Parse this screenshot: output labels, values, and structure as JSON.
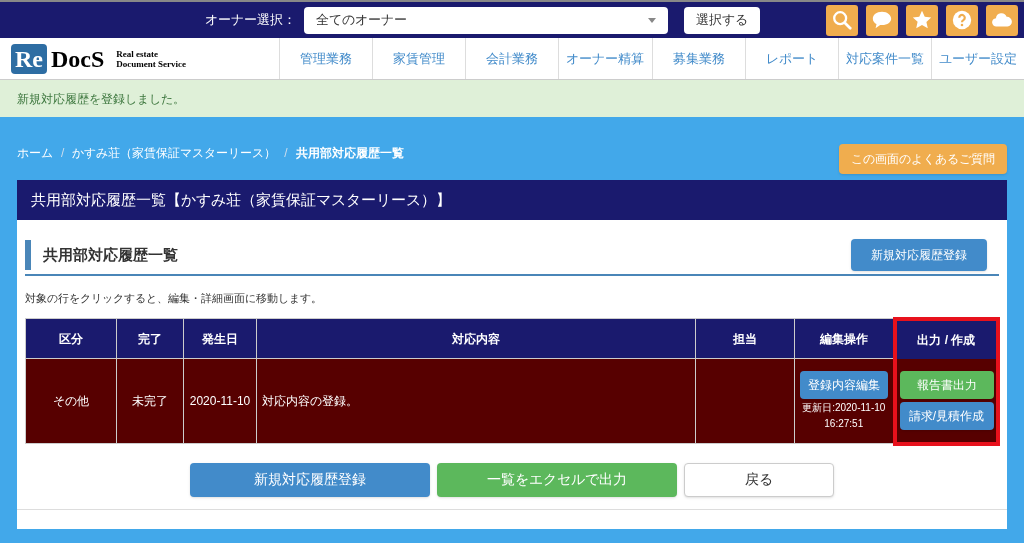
{
  "owner_select": {
    "label": "オーナー選択：",
    "value": "全てのオーナー",
    "button": "選択する"
  },
  "toolbar_icons": [
    {
      "kind": "search"
    },
    {
      "kind": "chat"
    },
    {
      "kind": "star"
    },
    {
      "kind": "help"
    },
    {
      "kind": "cloud"
    }
  ],
  "logo": {
    "mark": "Re",
    "name": "DocS",
    "tagline_1": "Real estate",
    "tagline_2": "Document Service"
  },
  "nav": [
    "管理業務",
    "家賃管理",
    "会計業務",
    "オーナー精算",
    "募集業務",
    "レポート",
    "対応案件一覧",
    "ユーザー設定"
  ],
  "alert": "新規対応履歴を登録しました。",
  "breadcrumb": [
    "ホーム",
    "かすみ荘（家賃保証マスターリース）",
    "共用部対応履歴一覧"
  ],
  "breadcrumb_separator": "/",
  "faq_button": "この画面のよくあるご質問",
  "panel_title": "共用部対応履歴一覧【かすみ荘（家賃保証マスターリース）】",
  "section_title": "共用部対応履歴一覧",
  "new_button": "新規対応履歴登録",
  "hint": "対象の行をクリックすると、編集・詳細画面に移動します。",
  "table": {
    "columns": [
      {
        "label": "区分",
        "highlighted": false
      },
      {
        "label": "完了",
        "highlighted": false
      },
      {
        "label": "発生日",
        "highlighted": false
      },
      {
        "label": "対応内容",
        "highlighted": false
      },
      {
        "label": "担当",
        "highlighted": false
      },
      {
        "label": "編集操作",
        "highlighted": false
      },
      {
        "label": "出力 / 作成",
        "highlighted": true
      }
    ],
    "rows": [
      {
        "category": "その他",
        "status": "未完了",
        "date": "2020-11-10",
        "content": "対応内容の登録。",
        "assignee": "",
        "edit_button": "登録内容編集",
        "updated": "更新日:2020-11-10",
        "updated_time": "16:27:51",
        "report_button": "報告書出力",
        "invoice_button": "請求/見積作成"
      }
    ]
  },
  "footer_buttons": [
    {
      "label": "新規対応履歴登録",
      "kind": "primary"
    },
    {
      "label": "一覧をエクセルで出力",
      "kind": "success"
    },
    {
      "label": "戻る",
      "kind": "default"
    }
  ]
}
